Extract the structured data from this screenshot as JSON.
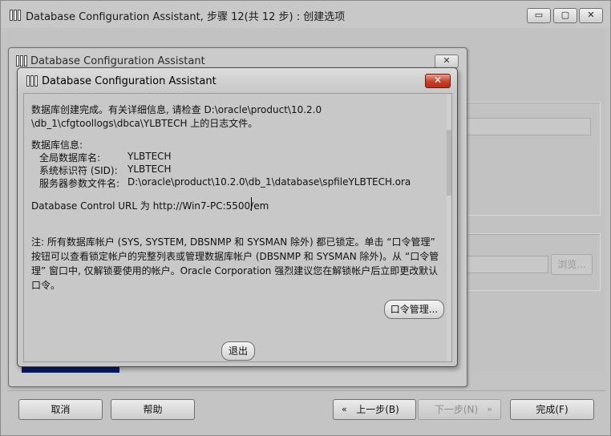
{
  "main_window": {
    "title": "Database Configuration Assistant, 步骤 12(共 12 步) : 创建选项",
    "controls": {
      "minimize": "▭",
      "maximize": "▢",
      "close": "✕"
    },
    "browse_label": "浏览...",
    "footer": {
      "cancel": "取消",
      "help": "帮助",
      "back": "上一步(B)",
      "next": "下一步(N)",
      "finish": "完成(F)",
      "back_chevron": "«",
      "next_chevron": "»"
    }
  },
  "progress_window": {
    "title": "Database Configuration Assistant",
    "close": "✕",
    "progress_color": "#0a1a5c"
  },
  "dialog": {
    "title": "Database Configuration Assistant",
    "close": "✕",
    "message_line1": "数据库创建完成。有关详细信息, 请检查 D:\\oracle\\product\\10.2.0",
    "message_line2": "\\db_1\\cfgtoollogs\\dbca\\YLBTECH 上的日志文件。",
    "info_heading": "数据库信息:",
    "info": [
      {
        "key": "全局数据库名:",
        "value": "YLBTECH"
      },
      {
        "key": "系统标识符 (SID):",
        "value": "YLBTECH"
      },
      {
        "key": "服务器参数文件名:",
        "value": "D:\\oracle\\product\\10.2.0\\db_1\\database\\spfileYLBTECH.ora"
      }
    ],
    "url_line": "Database Control URL 为 http://Win7-PC:5500/em",
    "note": "注: 所有数据库帐户 (SYS, SYSTEM, DBSNMP 和 SYSMAN 除外) 都已锁定。单击 “口令管理” 按钮可以查看锁定帐户的完整列表或管理数据库帐户 (DBSNMP 和 SYSMAN 除外)。从 “口令管理” 窗口中, 仅解锁要使用的帐户。Oracle Corporation 强烈建议您在解锁帐户后立即更改默认口令。",
    "password_button": "口令管理...",
    "exit_button": "退出",
    "close_button_color": "#c6402a"
  }
}
